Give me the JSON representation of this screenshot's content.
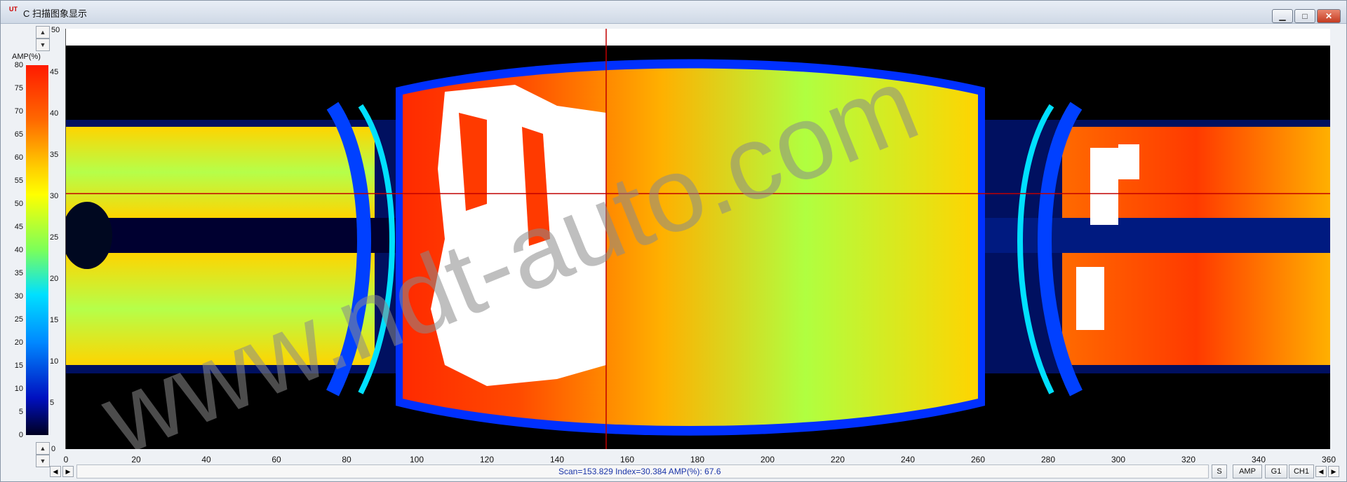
{
  "window": {
    "title": "C 扫描图象显示",
    "app_icon_text": "UT",
    "buttons": {
      "minimize": "▁",
      "maximize": "□",
      "close": "✕"
    }
  },
  "colorbar": {
    "label": "AMP(%)",
    "outer_ticks": [
      "80",
      "75",
      "70",
      "65",
      "60",
      "55",
      "50",
      "45",
      "40",
      "35",
      "30",
      "25",
      "20",
      "15",
      "10",
      "5",
      "0"
    ],
    "inner_ticks": [
      "45",
      "40",
      "35",
      "30",
      "25",
      "20",
      "15",
      "10",
      "5"
    ]
  },
  "plot": {
    "y_ticks": [
      "50",
      "0"
    ],
    "x_ticks": [
      "0",
      "20",
      "40",
      "60",
      "80",
      "100",
      "120",
      "140",
      "160",
      "180",
      "200",
      "220",
      "240",
      "260",
      "280",
      "300",
      "320",
      "340",
      "360"
    ],
    "cursor_scan": 153.829,
    "cursor_index": 30.384,
    "scan_max": 360,
    "index_max": 50,
    "watermark": "www.ndt-auto.com"
  },
  "status": {
    "readout": "Scan=153.829 Index=30.384  AMP(%): 67.6",
    "buttons": [
      "S",
      "AMP",
      "G1",
      "CH1"
    ]
  },
  "colors": {
    "hot": "#ff2a00",
    "warm": "#ffd400",
    "mid": "#7bff5a",
    "cool": "#00c8ff",
    "cold": "#0040ff",
    "background": "#000000",
    "saturation": "#ffffff",
    "cursor": "#c00000"
  }
}
